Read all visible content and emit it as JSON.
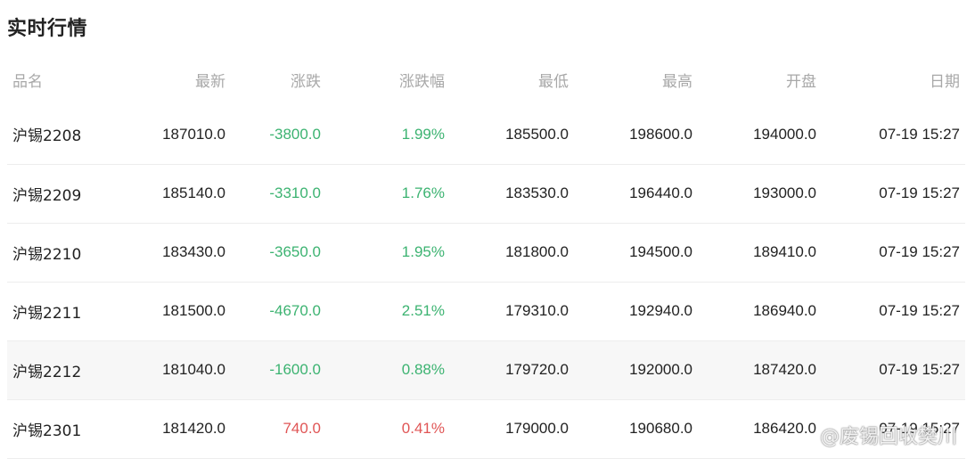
{
  "title": "实时行情",
  "columns": [
    "品名",
    "最新",
    "涨跌",
    "涨跌幅",
    "最低",
    "最高",
    "开盘",
    "日期"
  ],
  "rows": [
    [
      "沪锡2208",
      "187010.0",
      "-3800.0",
      "1.99%",
      "185500.0",
      "198600.0",
      "194000.0",
      "07-19 15:27"
    ],
    [
      "沪锡2209",
      "185140.0",
      "-3310.0",
      "1.76%",
      "183530.0",
      "196440.0",
      "193000.0",
      "07-19 15:27"
    ],
    [
      "沪锡2210",
      "183430.0",
      "-3650.0",
      "1.95%",
      "181800.0",
      "194500.0",
      "189410.0",
      "07-19 15:27"
    ],
    [
      "沪锡2211",
      "181500.0",
      "-4670.0",
      "2.51%",
      "179310.0",
      "192940.0",
      "186940.0",
      "07-19 15:27"
    ],
    [
      "沪锡2212",
      "181040.0",
      "-1600.0",
      "0.88%",
      "179720.0",
      "192000.0",
      "187420.0",
      "07-19 15:27"
    ],
    [
      "沪锡2301",
      "181420.0",
      "740.0",
      "0.41%",
      "179000.0",
      "190680.0",
      "186420.0",
      "07-19 15:27"
    ]
  ],
  "row_direction": [
    "down",
    "down",
    "down",
    "down",
    "down",
    "up"
  ],
  "colors": {
    "down": "#3cb371",
    "up": "#e05555",
    "header": "#a8a8a8",
    "highlight_row": "#f7f7f7"
  },
  "watermark": "@废锡回收樊川"
}
